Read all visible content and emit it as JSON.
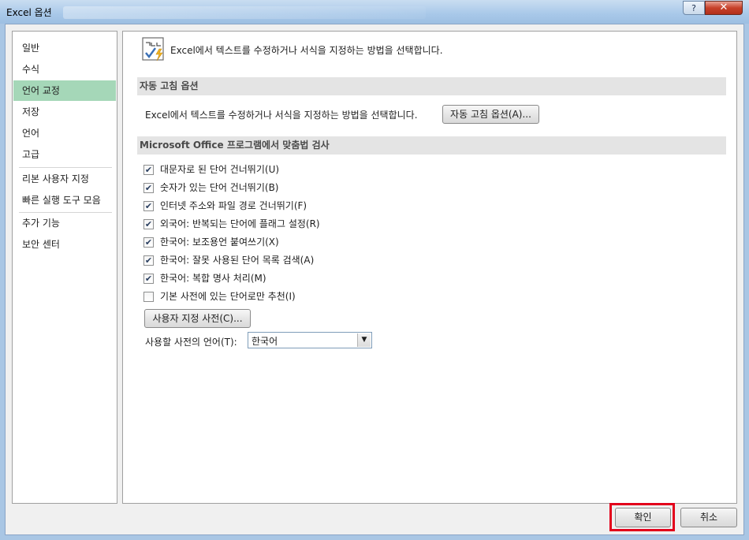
{
  "window": {
    "title": "Excel 옵션"
  },
  "title_buttons": {
    "help": "?",
    "close": "✕"
  },
  "sidebar": {
    "items": [
      {
        "label": "일반"
      },
      {
        "label": "수식"
      },
      {
        "label": "언어 교정"
      },
      {
        "label": "저장"
      },
      {
        "label": "언어"
      },
      {
        "label": "고급"
      },
      {
        "label": "리본 사용자 지정"
      },
      {
        "label": "빠른 실행 도구 모음"
      },
      {
        "label": "추가 기능"
      },
      {
        "label": "보안 센터"
      }
    ],
    "active_index": 2,
    "active_color": "#a5d7b8"
  },
  "header": {
    "icon": "proofing-abc-check-icon",
    "text": "Excel에서 텍스트를 수정하거나 서식을 지정하는 방법을 선택합니다."
  },
  "autocorrect": {
    "section_title": "자동 고침 옵션",
    "description": "Excel에서 텍스트를 수정하거나 서식을 지정하는 방법을 선택합니다.",
    "button_label": "자동 고침 옵션(A)..."
  },
  "spelling": {
    "section_title": "Microsoft Office 프로그램에서 맞춤법 검사",
    "options": [
      {
        "label": "대문자로 된 단어 건너뛰기(U)",
        "checked": true
      },
      {
        "label": "숫자가 있는 단어 건너뛰기(B)",
        "checked": true
      },
      {
        "label": "인터넷 주소와 파일 경로 건너뛰기(F)",
        "checked": true
      },
      {
        "label": "외국어: 반복되는 단어에 플래그 설정(R)",
        "checked": true
      },
      {
        "label": "한국어: 보조용언 붙여쓰기(X)",
        "checked": true
      },
      {
        "label": "한국어: 잘못 사용된 단어 목록 검색(A)",
        "checked": true
      },
      {
        "label": "한국어: 복합 명사 처리(M)",
        "checked": true
      },
      {
        "label": "기본 사전에 있는 단어로만 추천(I)",
        "checked": false
      }
    ],
    "custom_dict_button": "사용자 지정 사전(C)...",
    "dict_language_label": "사용할 사전의 언어(T):",
    "dict_language_value": "한국어"
  },
  "footer": {
    "ok_label": "확인",
    "cancel_label": "취소",
    "highlight_color": "#e3001b"
  }
}
